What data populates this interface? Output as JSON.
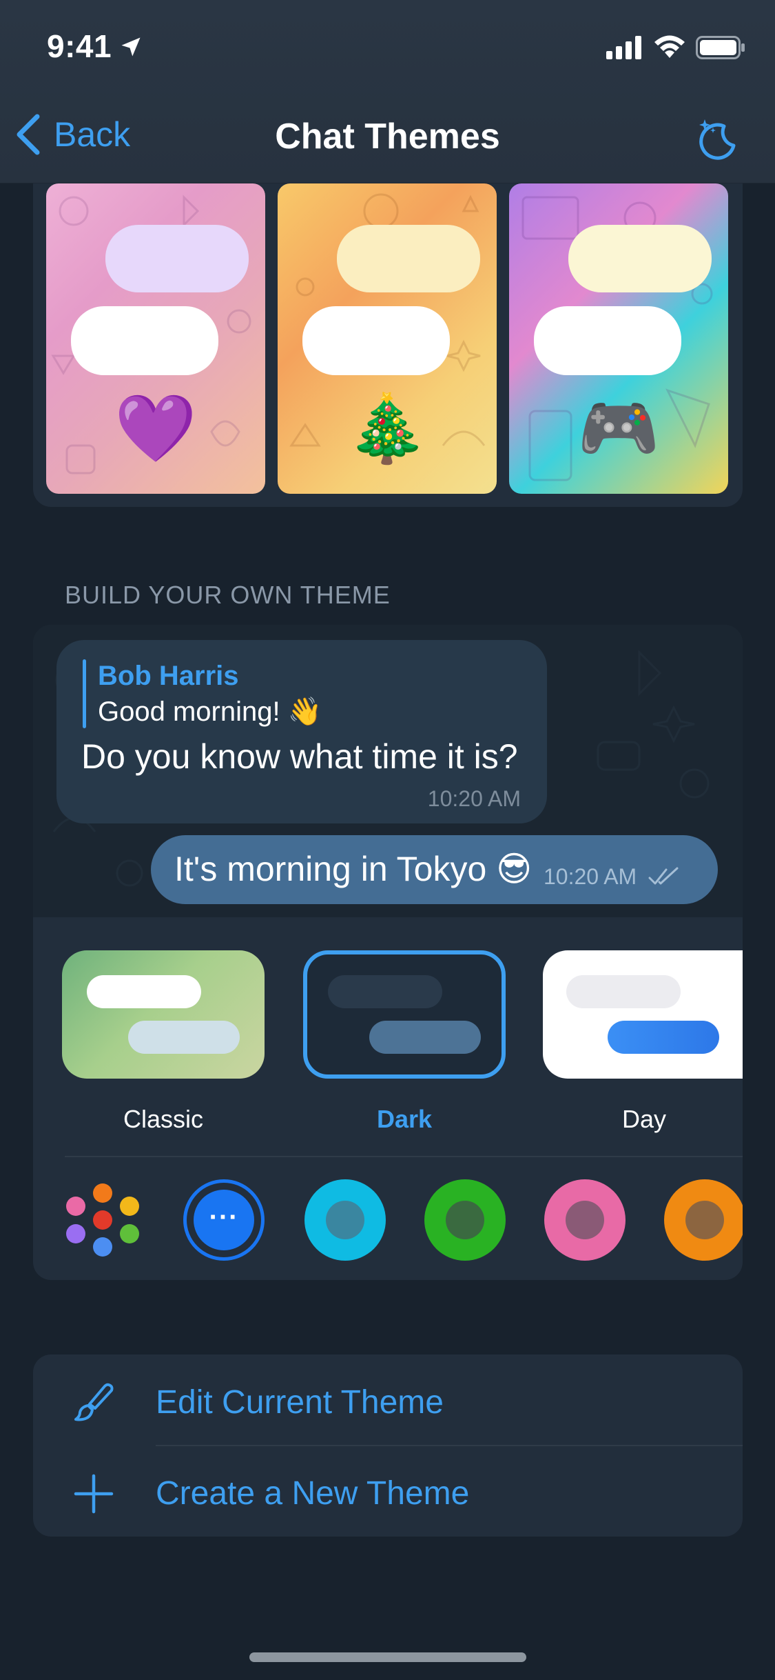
{
  "status_bar": {
    "time": "9:41"
  },
  "nav": {
    "back_label": "Back",
    "title": "Chat Themes"
  },
  "themes": [
    {
      "emoji": "💜"
    },
    {
      "emoji": "🎄"
    },
    {
      "emoji": "🎮"
    }
  ],
  "section": {
    "header": "BUILD YOUR OWN THEME"
  },
  "preview": {
    "incoming": {
      "reply_name": "Bob Harris",
      "reply_text": "Good morning! 👋",
      "text": "Do you know what time it is?",
      "time": "10:20 AM"
    },
    "outgoing": {
      "text": "It's morning in Tokyo 😎",
      "time": "10:20 AM"
    }
  },
  "theme_choices": [
    {
      "label": "Classic"
    },
    {
      "label": "Dark",
      "selected": true
    },
    {
      "label": "Day"
    }
  ],
  "swatches": {
    "more_label": "···"
  },
  "actions": {
    "edit_label": "Edit Current Theme",
    "create_label": "Create a New Theme"
  },
  "colors": {
    "accent": "#3e9ff0",
    "background": "#18222d",
    "card": "#222e3c",
    "swatch_blue": "#1975f2",
    "swatch_cyan": "#0fbbe3",
    "swatch_green": "#29b223",
    "swatch_pink": "#e86aa6",
    "swatch_orange": "#f08a12"
  }
}
